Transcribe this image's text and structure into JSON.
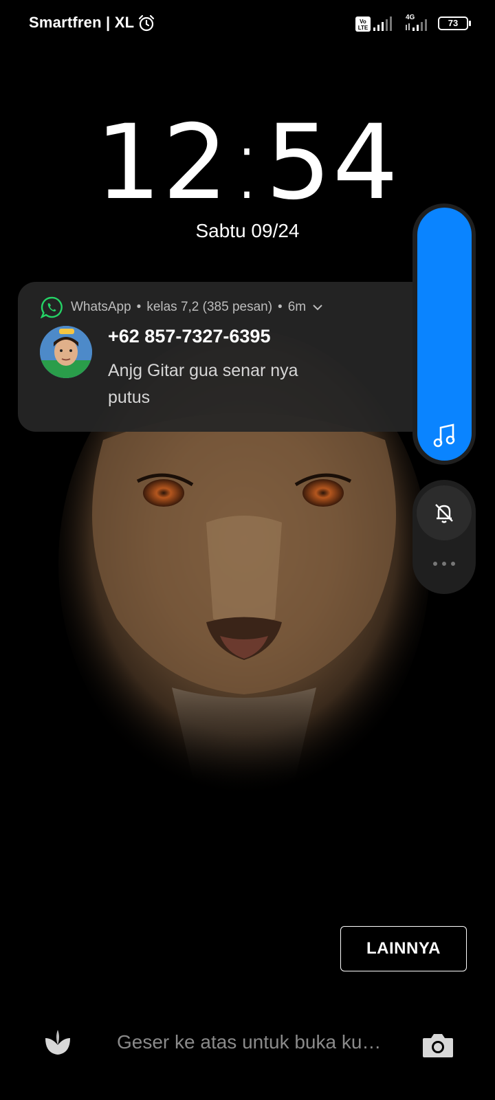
{
  "status_bar": {
    "carrier": "Smartfren | XL",
    "signal2_label": "4G",
    "battery": "73"
  },
  "lockscreen": {
    "time_hour": "12",
    "time_min": "54",
    "date": "Sabtu 09/24"
  },
  "notification": {
    "app": "WhatsApp",
    "group": "kelas 7,2 (385 pesan)",
    "age": "6m",
    "sender": "+62 857-7327-6395",
    "message": "Anjg Gitar gua senar nya putus"
  },
  "buttons": {
    "more": "LAINNYA"
  },
  "bottom": {
    "swipe_hint": "Geser ke atas untuk buka ku…"
  },
  "colors": {
    "accent": "#0a84ff",
    "whatsapp": "#25d366",
    "card": "#262626"
  },
  "icons": [
    "alarm-icon",
    "volte-icon",
    "signal-icon",
    "battery-icon",
    "whatsapp-icon",
    "chevron-down-icon",
    "music-note-icon",
    "bell-off-icon",
    "more-dots-icon",
    "theme-leaf-icon",
    "camera-icon"
  ]
}
